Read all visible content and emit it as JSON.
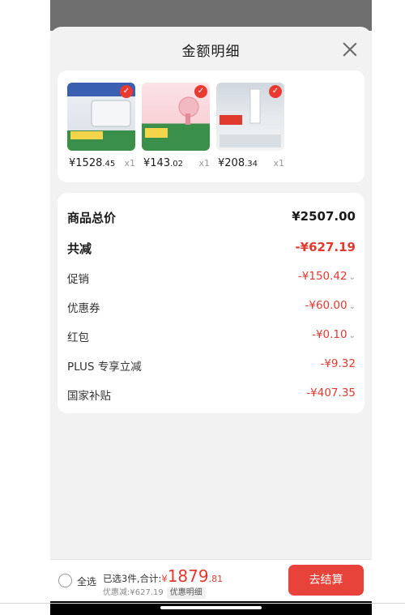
{
  "sheet": {
    "title": "金额明细"
  },
  "products": [
    {
      "price_int": "¥1528",
      "price_dec": ".45",
      "qty": "x1"
    },
    {
      "price_int": "¥143",
      "price_dec": ".02",
      "qty": "x1"
    },
    {
      "price_int": "¥208",
      "price_dec": ".34",
      "qty": "x1"
    }
  ],
  "details": {
    "total_label": "商品总价",
    "total_value": "¥2507.00",
    "discount_label": "共减",
    "discount_value": "-¥627.19",
    "promo_label": "促销",
    "promo_value": "-¥150.42",
    "coupon_label": "优惠券",
    "coupon_value": "-¥60.00",
    "redpacket_label": "红包",
    "redpacket_value": "-¥0.10",
    "plus_label": "PLUS 专享立减",
    "plus_value": "-¥9.32",
    "subsidy_label": "国家补贴",
    "subsidy_value": "-¥407.35"
  },
  "bottom": {
    "select_all": "全选",
    "summary_prefix": "已选3件,合计:",
    "currency": "¥",
    "amount_int": "1879",
    "amount_dec": ".81",
    "discount_text": "优惠减:¥627.19",
    "detail_tag": "优惠明细",
    "checkout": "去结算"
  },
  "colors": {
    "accent": "#e2392f",
    "button": "#e8433a"
  }
}
